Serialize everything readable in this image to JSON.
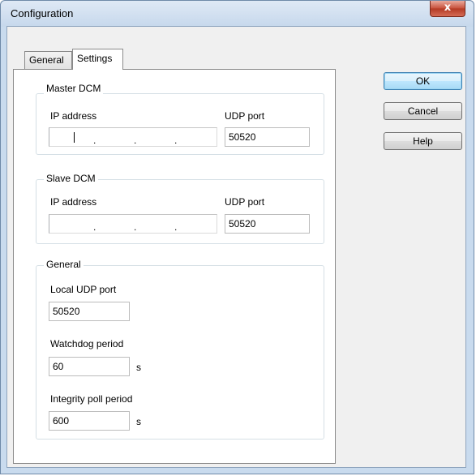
{
  "window": {
    "title": "Configuration",
    "close_symbol": "x"
  },
  "tabs": [
    {
      "label": "General"
    },
    {
      "label": "Settings"
    }
  ],
  "master": {
    "group_title": "Master DCM",
    "ip_label": "IP address",
    "udp_label": "UDP port",
    "udp_value": "50520"
  },
  "slave": {
    "group_title": "Slave DCM",
    "ip_label": "IP address",
    "udp_label": "UDP port",
    "udp_value": "50520"
  },
  "general": {
    "group_title": "General",
    "local_udp_label": "Local UDP port",
    "local_udp_value": "50520",
    "watchdog_label": "Watchdog period",
    "watchdog_value": "60",
    "watchdog_unit": "s",
    "integrity_label": "Integrity poll period",
    "integrity_value": "600",
    "integrity_unit": "s"
  },
  "buttons": {
    "ok": "OK",
    "cancel": "Cancel",
    "help": "Help"
  },
  "ip_separator": "."
}
